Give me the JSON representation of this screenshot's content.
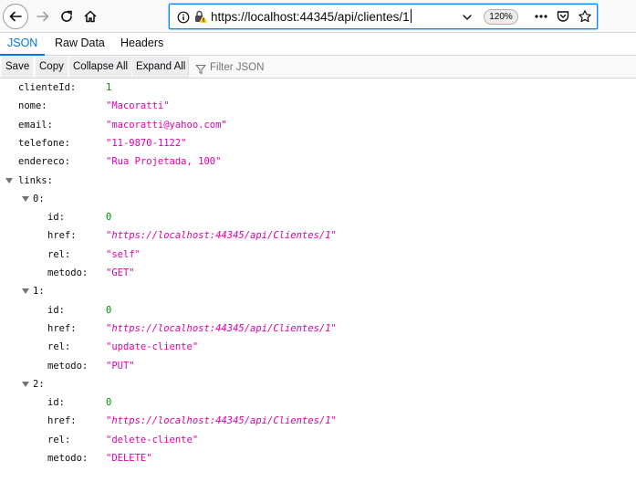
{
  "browser": {
    "url": "https://localhost:44345/api/clientes/1",
    "zoom": "120%",
    "icons": {
      "back": "back-arrow-icon",
      "forward": "forward-arrow-icon",
      "reload": "reload-icon",
      "home": "home-icon",
      "info": "info-icon",
      "lock": "lock-warning-icon",
      "dropdown": "chevron-down-icon",
      "menu": "more-dots-icon",
      "pocket": "pocket-icon",
      "bookmark": "star-icon"
    }
  },
  "tabs": [
    {
      "label": "JSON",
      "active": true
    },
    {
      "label": "Raw Data",
      "active": false
    },
    {
      "label": "Headers",
      "active": false
    }
  ],
  "actions": {
    "save": "Save",
    "copy": "Copy",
    "collapse_all": "Collapse All",
    "expand_all": "Expand All",
    "filter_placeholder": "Filter JSON"
  },
  "json": {
    "clienteId": {
      "key": "clienteId:",
      "value": "1"
    },
    "nome": {
      "key": "nome:",
      "value": "\"Macoratti\""
    },
    "email": {
      "key": "email:",
      "value": "\"macoratti@yahoo.com\""
    },
    "telefone": {
      "key": "telefone:",
      "value": "\"11-9870-1122\""
    },
    "endereco": {
      "key": "endereco:",
      "value": "\"Rua Projetada, 100\""
    },
    "links_key": "links:",
    "links": [
      {
        "index": "0:",
        "id": {
          "key": "id:",
          "value": "0"
        },
        "href": {
          "key": "href:",
          "value": "\"https://localhost:44345/api/Clientes/1\""
        },
        "rel": {
          "key": "rel:",
          "value": "\"self\""
        },
        "metodo": {
          "key": "metodo:",
          "value": "\"GET\""
        }
      },
      {
        "index": "1:",
        "id": {
          "key": "id:",
          "value": "0"
        },
        "href": {
          "key": "href:",
          "value": "\"https://localhost:44345/api/Clientes/1\""
        },
        "rel": {
          "key": "rel:",
          "value": "\"update-cliente\""
        },
        "metodo": {
          "key": "metodo:",
          "value": "\"PUT\""
        }
      },
      {
        "index": "2:",
        "id": {
          "key": "id:",
          "value": "0"
        },
        "href": {
          "key": "href:",
          "value": "\"https://localhost:44345/api/Clientes/1\""
        },
        "rel": {
          "key": "rel:",
          "value": "\"delete-cliente\""
        },
        "metodo": {
          "key": "metodo:",
          "value": "\"DELETE\""
        }
      }
    ]
  },
  "colors": {
    "accent": "#0074e8",
    "number": "#058b00",
    "string": "#dd00a9"
  }
}
